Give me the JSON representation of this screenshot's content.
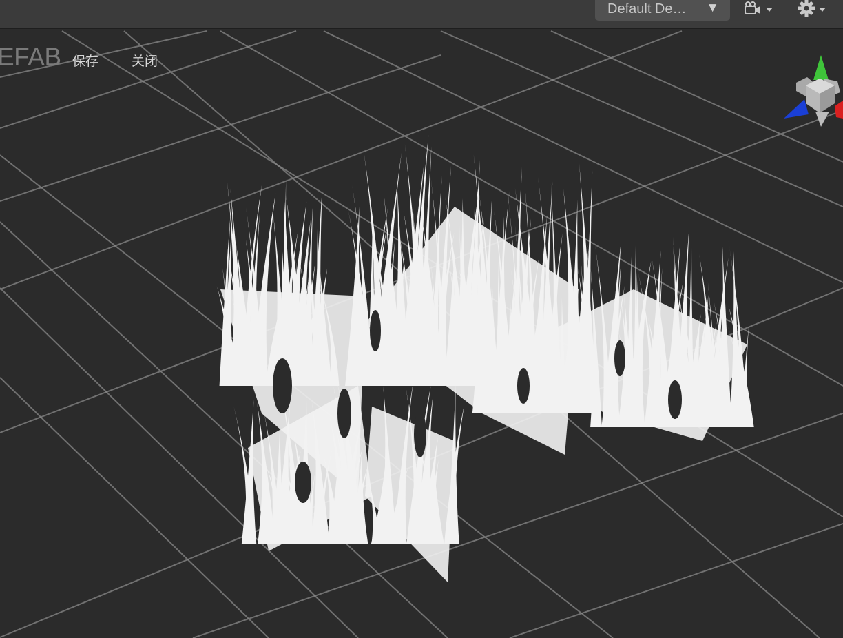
{
  "toolbar": {
    "render_mode_label": "Default De…",
    "render_mode_icon": "triangle-down-icon",
    "camera_icon": "camera-icon",
    "settings_icon": "gear-icon"
  },
  "prefab": {
    "title": "EFAB",
    "save_label": "保存",
    "close_label": "关闭"
  },
  "scene": {
    "background_color": "#2b2b2b",
    "grid_color": "#8a8a8a",
    "mesh_color": "#f2f2f2",
    "gizmo_axes": [
      {
        "axis": "y",
        "color": "#3fc43a"
      },
      {
        "axis": "z",
        "color": "#1a3fd6"
      },
      {
        "axis": "x",
        "color": "#d92020"
      }
    ]
  }
}
